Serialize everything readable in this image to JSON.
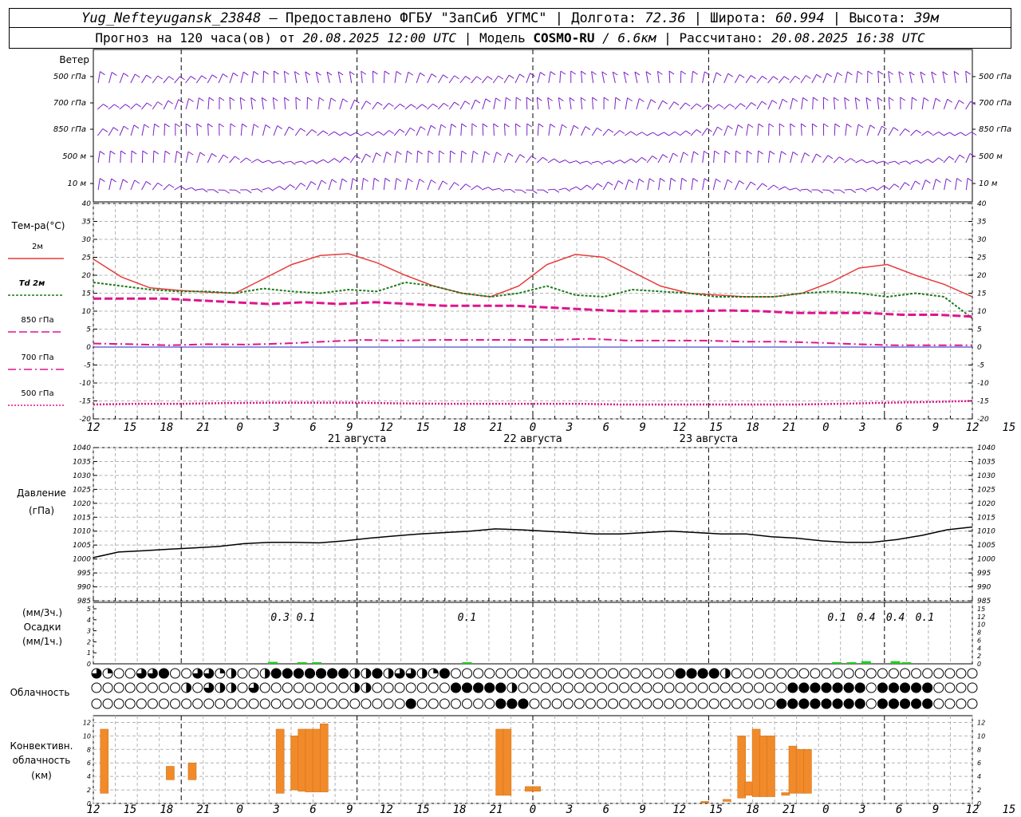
{
  "header": {
    "station": "Yug_Nefteyugansk_23848",
    "sep1": " – ",
    "provided": "Предоставлено ФГБУ \"ЗапСиб УГМС\"",
    "lon_label": "Долгота: ",
    "lon_value": "72.36",
    "lat_label": "Широта: ",
    "lat_value": "60.994",
    "alt_label": "Высота: ",
    "alt_value": "39м",
    "forecast_prefix": "Прогноз на 120 часа(ов) от ",
    "forecast_time": "20.08.2025 12:00 UTC",
    "model_label": "Модель ",
    "model_name": "COSMO-RU",
    "model_res": " / 6.6км",
    "computed_label": "Рассчитано: ",
    "computed_time": "20.08.2025 16:38 UTC",
    "pipe": " | "
  },
  "time_axis": {
    "hour_ticks": [
      "12",
      "15",
      "18",
      "21",
      "0",
      "3",
      "6",
      "9",
      "12",
      "15",
      "18",
      "21",
      "0",
      "3",
      "6",
      "9",
      "12",
      "15",
      "18",
      "21",
      "0",
      "3",
      "6",
      "9",
      "12",
      "15",
      "18"
    ],
    "day_labels": [
      "21 августа",
      "22 августа",
      "23 августа"
    ]
  },
  "wind_panel": {
    "title": "Ветер",
    "levels": [
      "500 гПа",
      "700 гПа",
      "850 гПа",
      "500 м",
      "10 м"
    ],
    "color": "#7a1fc8"
  },
  "chart_data": [
    {
      "type": "line",
      "title": "Тем-ра(°C)",
      "x": [
        0,
        3,
        6,
        9,
        12,
        15,
        18,
        21,
        24,
        27,
        30,
        33,
        36,
        39,
        42,
        45,
        48,
        51,
        54,
        57,
        60,
        63,
        66,
        69,
        72,
        75,
        78,
        81,
        84,
        87,
        90,
        93,
        96,
        99,
        102,
        105,
        108,
        111,
        114,
        117,
        120
      ],
      "ylim": [
        -20,
        40
      ],
      "yticks": [
        -20,
        -15,
        -10,
        -5,
        0,
        5,
        10,
        15,
        20,
        25,
        30,
        35,
        40
      ],
      "series": [
        {
          "name": "2м",
          "color": "#e83a3a",
          "values": [
            24.5,
            19.5,
            16.5,
            15.8,
            15.3,
            15,
            19,
            23,
            25.5,
            26,
            23.5,
            20,
            17,
            15,
            14,
            17,
            23,
            25.8,
            25,
            21,
            17,
            15,
            14.5,
            14,
            14,
            15,
            18,
            22,
            23,
            20,
            17.5,
            14
          ]
        },
        {
          "name": "Td 2м",
          "color": "#1a7a1a",
          "values": [
            18,
            17,
            16,
            15.5,
            15.5,
            15,
            16.3,
            15.5,
            15,
            16,
            15.5,
            18,
            17,
            15,
            14,
            15,
            17,
            14.5,
            14,
            16,
            15.5,
            15,
            14,
            14,
            14,
            15,
            15.5,
            15,
            14,
            15,
            14,
            8
          ]
        },
        {
          "name": "850 гПа",
          "color": "#e0148c",
          "values": [
            13.5,
            13.5,
            13.5,
            13,
            12.5,
            12,
            12.5,
            12,
            12.5,
            12,
            11.5,
            11.5,
            11.5,
            11,
            10.5,
            10,
            10,
            10,
            10.2,
            10,
            9.5,
            9.5,
            9.5,
            9,
            9,
            8.5
          ]
        },
        {
          "name": "700 гПа",
          "color": "#e0148c",
          "values": [
            1,
            0.8,
            0.5,
            0.8,
            0.7,
            1,
            1.5,
            2,
            1.8,
            2,
            2,
            2,
            2,
            2.3,
            1.8,
            1.8,
            1.8,
            1.5,
            1.5,
            1.2,
            0.8,
            0.5,
            0.5,
            0.5
          ]
        },
        {
          "name": "500 гПа",
          "color": "#e0148c",
          "values": [
            -16,
            -15.8,
            -15.8,
            -15.6,
            -15.5,
            -15.5,
            -15.5,
            -15.7,
            -15.8,
            -15.8,
            -15.8,
            -15.8,
            -16,
            -16,
            -16,
            -16,
            -16,
            -15.8,
            -15.5,
            -15.3,
            -15
          ]
        }
      ]
    },
    {
      "type": "line",
      "title": "Давление",
      "subtitle": "(гПа)",
      "ylim": [
        985,
        1040
      ],
      "yticks": [
        985,
        990,
        995,
        1000,
        1005,
        1010,
        1015,
        1020,
        1025,
        1030,
        1035,
        1040
      ],
      "series": [
        {
          "color": "#000000",
          "values": [
            1000.5,
            1002.5,
            1003,
            1003.5,
            1004,
            1004.5,
            1005.5,
            1006,
            1006,
            1005.8,
            1006.5,
            1007.5,
            1008.3,
            1009,
            1009.5,
            1010,
            1010.8,
            1010.5,
            1010,
            1009.5,
            1009,
            1009,
            1009.5,
            1010,
            1009.5,
            1009,
            1009,
            1008,
            1007.5,
            1006.5,
            1006,
            1006,
            1007,
            1008.5,
            1010.5,
            1011.5
          ]
        }
      ]
    },
    {
      "type": "bar",
      "title": "Осадки",
      "units_3h": "(мм/3ч.)",
      "units_1h": "(мм/1ч.)",
      "ylim": [
        0,
        5
      ],
      "yticks": [
        0,
        1,
        2,
        3,
        4,
        5
      ],
      "yticks_right": [
        0,
        2,
        4,
        6,
        8,
        10,
        12,
        15
      ],
      "labels": [
        {
          "hour": 25.5,
          "text": "0.3"
        },
        {
          "hour": 29,
          "text": "0.1"
        },
        {
          "hour": 51,
          "text": "0.1"
        },
        {
          "hour": 101.5,
          "text": "0.1"
        },
        {
          "hour": 105.5,
          "text": "0.4"
        },
        {
          "hour": 109.5,
          "text": "0.4"
        },
        {
          "hour": 113.5,
          "text": "0.1"
        }
      ],
      "bars": [
        {
          "hour": 24.5,
          "value": 0.3
        },
        {
          "hour": 28.5,
          "value": 0.1
        },
        {
          "hour": 30.5,
          "value": 0.1
        },
        {
          "hour": 51,
          "value": 0.05
        },
        {
          "hour": 101.5,
          "value": 0.1
        },
        {
          "hour": 103.5,
          "value": 0.1
        },
        {
          "hour": 105.5,
          "value": 0.4
        },
        {
          "hour": 109.5,
          "value": 0.4
        },
        {
          "hour": 111,
          "value": 0.1
        }
      ]
    },
    {
      "type": "table",
      "title": "Облачность",
      "rows": [
        "3100033341003332120004242444444442224422332212400000000000000000000000000000044444423000000000000000000000000000000000",
        "0000000000022030220031000000000000222000000000044444442200000000000000000000000000000000000042444444440044444440000000",
        "0000000000000000000000000000000000000000040000000000044444000000000000000000000000000000000444444444440044444440000000"
      ]
    },
    {
      "type": "bar",
      "title": "Конвективн.",
      "subtitle": "облачность",
      "units": "(км)",
      "ylim": [
        0,
        13
      ],
      "yticks": [
        0,
        2,
        4,
        6,
        8,
        10,
        12
      ],
      "bars": [
        {
          "hour": 1,
          "bottom": 1.5,
          "top": 11
        },
        {
          "hour": 10,
          "bottom": 3.5,
          "top": 5.5
        },
        {
          "hour": 13,
          "bottom": 3.5,
          "top": 6
        },
        {
          "hour": 25,
          "bottom": 1.5,
          "top": 11
        },
        {
          "hour": 27,
          "bottom": 2,
          "top": 10
        },
        {
          "hour": 28,
          "bottom": 1.8,
          "top": 11
        },
        {
          "hour": 29,
          "bottom": 1.7,
          "top": 11
        },
        {
          "hour": 30,
          "bottom": 1.7,
          "top": 11
        },
        {
          "hour": 31,
          "bottom": 1.7,
          "top": 11.8
        },
        {
          "hour": 55,
          "bottom": 1.2,
          "top": 11
        },
        {
          "hour": 56,
          "bottom": 1.2,
          "top": 11
        },
        {
          "hour": 59,
          "bottom": 1.8,
          "top": 2.5
        },
        {
          "hour": 60,
          "bottom": 1.8,
          "top": 2.5
        },
        {
          "hour": 83,
          "bottom": 0.1,
          "top": 0.3
        },
        {
          "hour": 86,
          "bottom": 0.3,
          "top": 0.6
        },
        {
          "hour": 88,
          "bottom": 0.8,
          "top": 10
        },
        {
          "hour": 89,
          "bottom": 1.2,
          "top": 3.2
        },
        {
          "hour": 90,
          "bottom": 1,
          "top": 11
        },
        {
          "hour": 91,
          "bottom": 1,
          "top": 10
        },
        {
          "hour": 92,
          "bottom": 1,
          "top": 10
        },
        {
          "hour": 94,
          "bottom": 1.2,
          "top": 1.6
        },
        {
          "hour": 95,
          "bottom": 1.5,
          "top": 8.5
        },
        {
          "hour": 96,
          "bottom": 1.5,
          "top": 8
        },
        {
          "hour": 97,
          "bottom": 1.5,
          "top": 8
        }
      ]
    }
  ]
}
